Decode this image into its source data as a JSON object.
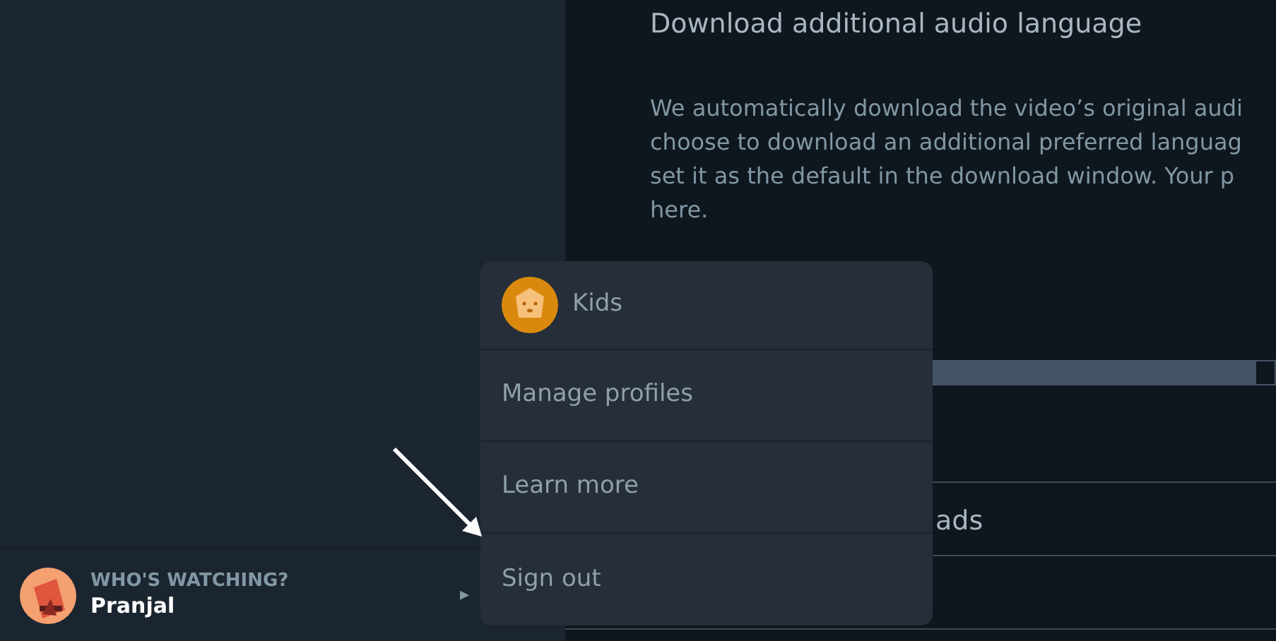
{
  "content": {
    "title": "Download additional audio language",
    "paragraph_lines": [
      "We automatically download the video’s original audi",
      "choose to download an additional preferred languag",
      "set it as the default in the download window. Your p",
      "here."
    ],
    "partial_label": "ads"
  },
  "profile": {
    "caption": "WHO'S WATCHING?",
    "name": "Pranjal",
    "caret": "▸"
  },
  "menu": {
    "items": [
      {
        "kind": "profile",
        "label": "Kids"
      },
      {
        "kind": "link",
        "label": "Manage profiles"
      },
      {
        "kind": "link",
        "label": "Learn more"
      },
      {
        "kind": "link",
        "label": "Sign out"
      }
    ]
  }
}
